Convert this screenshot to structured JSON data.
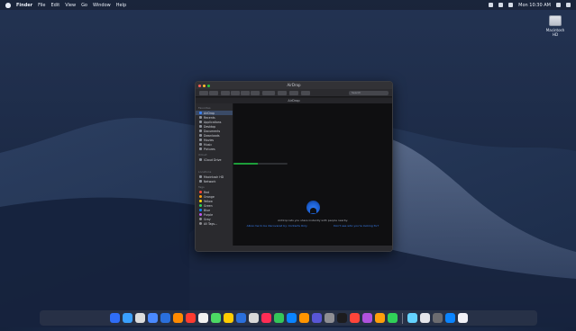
{
  "menubar": {
    "app_name": "Finder",
    "items": [
      "File",
      "Edit",
      "View",
      "Go",
      "Window",
      "Help"
    ],
    "right_text": "Mon 10:30 AM"
  },
  "desktop_icon": {
    "label": "Macintosh HD"
  },
  "finder": {
    "title": "AirDrop",
    "path": "AirDrop",
    "search_placeholder": "Search",
    "sidebar": {
      "favorites_header": "Favorites",
      "favorites": [
        {
          "label": "AirDrop",
          "color": "#3b82f6"
        },
        {
          "label": "Recents",
          "color": "#8a8f98"
        },
        {
          "label": "Applications",
          "color": "#8a8f98"
        },
        {
          "label": "Desktop",
          "color": "#8a8f98"
        },
        {
          "label": "Documents",
          "color": "#8a8f98"
        },
        {
          "label": "Downloads",
          "color": "#8a8f98"
        },
        {
          "label": "Movies",
          "color": "#8a8f98"
        },
        {
          "label": "Music",
          "color": "#8a8f98"
        },
        {
          "label": "Pictures",
          "color": "#8a8f98"
        }
      ],
      "icloud_header": "iCloud",
      "icloud": [
        {
          "label": "iCloud Drive",
          "color": "#8a8f98"
        }
      ],
      "locations_header": "Locations",
      "locations": [
        {
          "label": "Macintosh HD",
          "color": "#8a8f98"
        },
        {
          "label": "Network",
          "color": "#8a8f98"
        }
      ],
      "tags_header": "Tags",
      "tags": [
        {
          "label": "Red",
          "color": "#ff453a"
        },
        {
          "label": "Orange",
          "color": "#ff9f0a"
        },
        {
          "label": "Yellow",
          "color": "#ffd60a"
        },
        {
          "label": "Green",
          "color": "#30d158"
        },
        {
          "label": "Blue",
          "color": "#0a84ff"
        },
        {
          "label": "Purple",
          "color": "#bf5af2"
        },
        {
          "label": "Gray",
          "color": "#8e8e93"
        },
        {
          "label": "All Tags...",
          "color": "#8e8e93"
        }
      ]
    },
    "progress": {
      "label": "iCloud Drive",
      "value": 0.45,
      "color": "#1d9e3a"
    },
    "airdrop": {
      "message": "AirDrop lets you share instantly with people nearby.",
      "link_left": "Allow me to be discovered by: Contacts Only",
      "link_right": "Don't see who you're looking for?"
    },
    "status": ""
  },
  "dock": {
    "colors": [
      "#2f6df6",
      "#3aa0ff",
      "#dcdcdc",
      "#4a89ff",
      "#2a6fdc",
      "#ff8a00",
      "#ff3b30",
      "#f2f2f2",
      "#4cd964",
      "#ffcc00",
      "#2a6fdc",
      "#d9d9d9",
      "#ff2d55",
      "#34c759",
      "#0a84ff",
      "#ff9500",
      "#5856d6",
      "#8e8e93",
      "#1c1c1e",
      "#ff453a",
      "#af52de",
      "#ff9f0a",
      "#30d158",
      "#64d2ff",
      "#e5e5ea",
      "#6c6c70",
      "#0a84ff",
      "#f2f2f7"
    ]
  }
}
